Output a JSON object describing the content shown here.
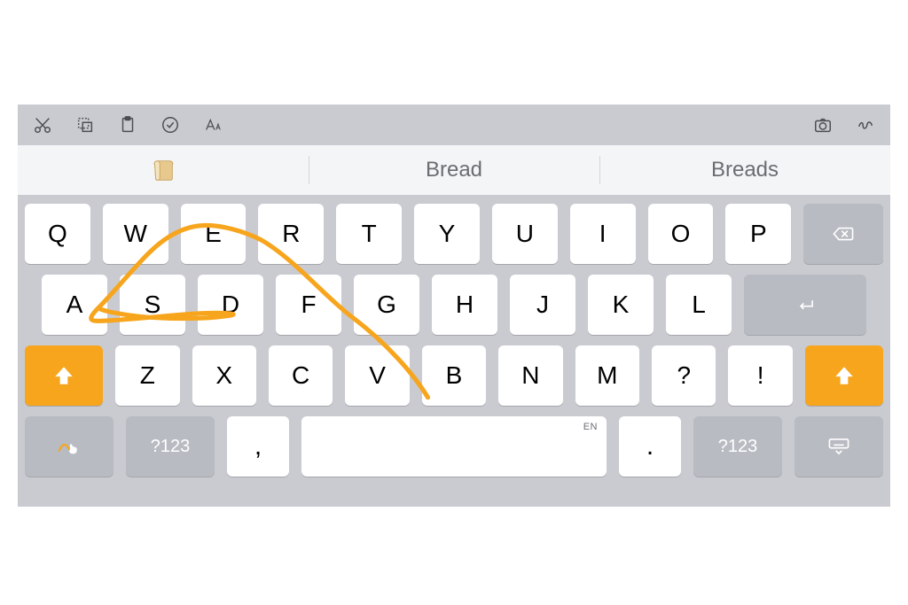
{
  "toolbar": {
    "icons": [
      "cut-icon",
      "copy-icon",
      "paste-icon",
      "check-icon",
      "text-format-icon",
      "camera-icon",
      "scribble-icon"
    ]
  },
  "suggestions": {
    "items": [
      {
        "kind": "emoji",
        "name": "bread-emoji"
      },
      {
        "kind": "text",
        "label": "Bread"
      },
      {
        "kind": "text",
        "label": "Breads"
      }
    ]
  },
  "rows": {
    "row1": [
      "Q",
      "W",
      "E",
      "R",
      "T",
      "Y",
      "U",
      "I",
      "O",
      "P"
    ],
    "row2": [
      "A",
      "S",
      "D",
      "F",
      "G",
      "H",
      "J",
      "K",
      "L"
    ],
    "row3": [
      "Z",
      "X",
      "C",
      "V",
      "B",
      "N",
      "M",
      "?",
      "!"
    ]
  },
  "bottom": {
    "num_label": "?123",
    "comma": ",",
    "period": ".",
    "space_lang": "EN"
  },
  "colors": {
    "accent": "#f7a51d",
    "keyboard_bg": "#c9cbd1",
    "key_gray": "#b8bbc2"
  }
}
